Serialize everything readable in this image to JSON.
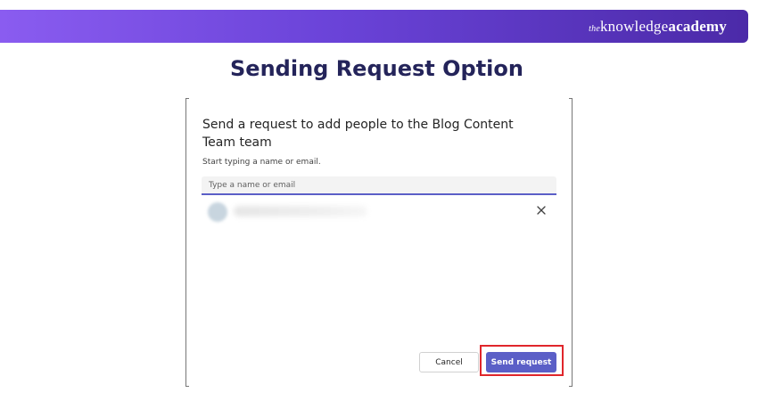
{
  "brand": {
    "logo_prefix": "the",
    "logo_main": "knowledge",
    "logo_bold": "academy",
    "colors": {
      "gradient_start": "#8a5cf0",
      "gradient_end": "#4b2aa8"
    }
  },
  "page_title": "Sending Request Option",
  "dialog": {
    "heading": "Send a request to add people to the Blog Content Team team",
    "hint": "Start typing a name or email.",
    "search": {
      "placeholder": "Type a name or email",
      "value": ""
    },
    "selected_people": [
      {
        "name": "",
        "avatar": "person-avatar",
        "remove_icon": "close-icon"
      }
    ],
    "cancel_label": "Cancel",
    "send_label": "Send request",
    "accent_color": "#5b5fc7",
    "highlight_color": "#e0262b"
  }
}
